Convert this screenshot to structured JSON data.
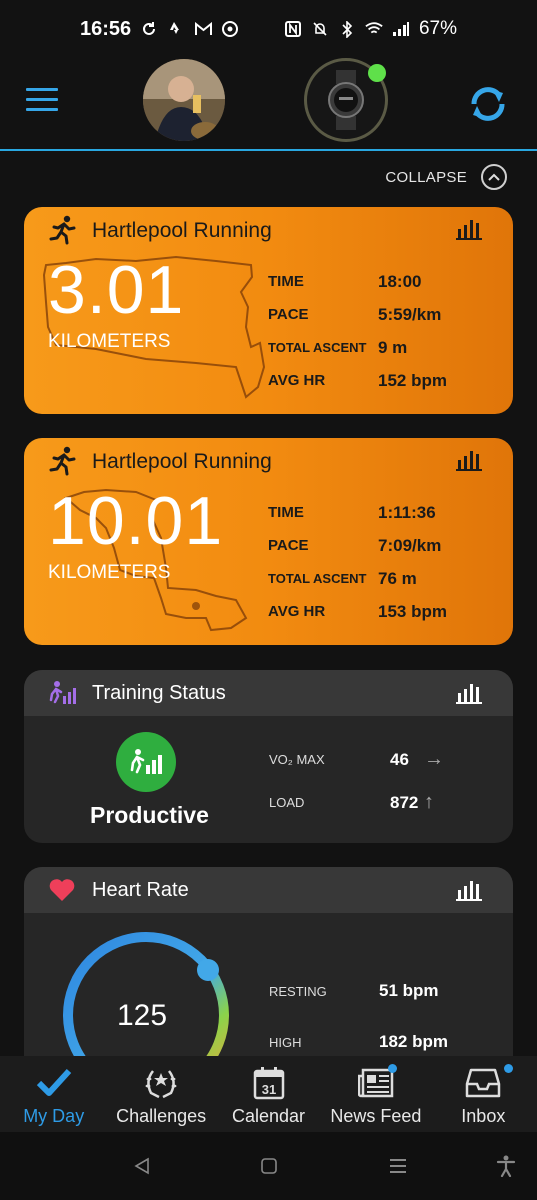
{
  "status_bar": {
    "time": "16:56",
    "left_icons": [
      "sync-icon",
      "strava-icon",
      "gmail-icon",
      "chrome-icon"
    ],
    "right_icons": [
      "nfc-icon",
      "mute-icon",
      "bluetooth-icon",
      "wifi-icon",
      "signal-icon"
    ],
    "battery": "67%"
  },
  "header": {
    "menu_icon": "hamburger-menu-icon",
    "avatar": "user-avatar",
    "device": "watch-device",
    "device_status_color": "#5fe04a",
    "sync_icon": "sync-icon",
    "accent_color": "#36a6e8"
  },
  "collapse": {
    "label": "COLLAPSE"
  },
  "activities": [
    {
      "title": "Hartlepool Running",
      "distance": "3.01",
      "unit": "KILOMETERS",
      "stats": [
        {
          "label": "TIME",
          "value": "18:00"
        },
        {
          "label": "PACE",
          "value": "5:59/km"
        },
        {
          "label": "TOTAL ASCENT",
          "value": "9 m"
        },
        {
          "label": "AVG HR",
          "value": "152 bpm"
        }
      ]
    },
    {
      "title": "Hartlepool Running",
      "distance": "10.01",
      "unit": "KILOMETERS",
      "stats": [
        {
          "label": "TIME",
          "value": "1:11:36"
        },
        {
          "label": "PACE",
          "value": "7:09/km"
        },
        {
          "label": "TOTAL ASCENT",
          "value": "76 m"
        },
        {
          "label": "AVG HR",
          "value": "153 bpm"
        }
      ]
    }
  ],
  "training_status": {
    "title": "Training Status",
    "status": "Productive",
    "status_color": "#2fae3f",
    "vo2_label": "VO₂ MAX",
    "vo2_value": "46",
    "vo2_trend": "→",
    "load_label": "LOAD",
    "load_value": "872",
    "load_trend": "↑"
  },
  "heart_rate": {
    "title": "Heart Rate",
    "current": "125",
    "resting_label": "RESTING",
    "resting_value": "51 bpm",
    "high_label": "HIGH",
    "high_value": "182 bpm"
  },
  "bottom_nav": [
    {
      "label": "My Day",
      "icon": "checkmark-icon",
      "active": true
    },
    {
      "label": "Challenges",
      "icon": "laurel-icon",
      "active": false
    },
    {
      "label": "Calendar",
      "icon": "calendar-icon",
      "day": "31",
      "active": false
    },
    {
      "label": "News Feed",
      "icon": "newspaper-icon",
      "active": false,
      "badge": true
    },
    {
      "label": "Inbox",
      "icon": "inbox-icon",
      "active": false,
      "badge": true
    }
  ]
}
